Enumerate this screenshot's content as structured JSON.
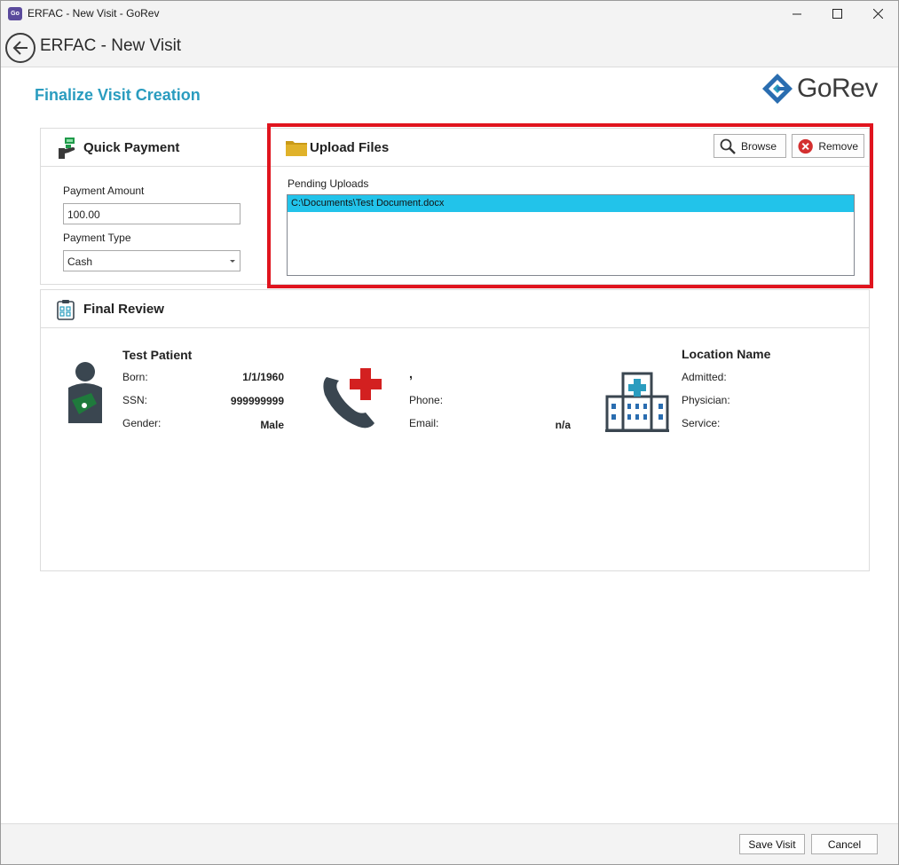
{
  "window": {
    "title": "ERFAC - New Visit - GoRev",
    "app_icon_text": "GoRev"
  },
  "header": {
    "title": "ERFAC - New Visit"
  },
  "page": {
    "title": "Finalize Visit Creation"
  },
  "logo": {
    "text": "GoRev"
  },
  "quick_payment": {
    "title": "Quick Payment",
    "amount_label": "Payment Amount",
    "amount_value": "100.00",
    "type_label": "Payment Type",
    "type_value": "Cash"
  },
  "upload_files": {
    "title": "Upload Files",
    "browse_label": "Browse",
    "remove_label": "Remove",
    "pending_label": "Pending Uploads",
    "pending_items": [
      "C:\\Documents\\Test Document.docx"
    ]
  },
  "final_review": {
    "title": "Final Review",
    "patient": {
      "name": "Test Patient",
      "born_label": "Born:",
      "born_value": "1/1/1960",
      "ssn_label": "SSN:",
      "ssn_value": "999999999",
      "gender_label": "Gender:",
      "gender_value": "Male"
    },
    "contact": {
      "name": ",",
      "phone_label": "Phone:",
      "phone_value": "",
      "email_label": "Email:",
      "email_value": "n/a"
    },
    "location": {
      "name": "Location Name",
      "admitted_label": "Admitted:",
      "physician_label": "Physician:",
      "service_label": "Service:"
    }
  },
  "footer": {
    "save_label": "Save Visit",
    "cancel_label": "Cancel"
  },
  "colors": {
    "accent": "#2a9cbf",
    "selection": "#22c3ea",
    "highlight": "#e0141e",
    "icon_green": "#1f7a3c",
    "icon_red": "#d32020",
    "icon_dark": "#3a4650",
    "folder": "#d6a820"
  }
}
